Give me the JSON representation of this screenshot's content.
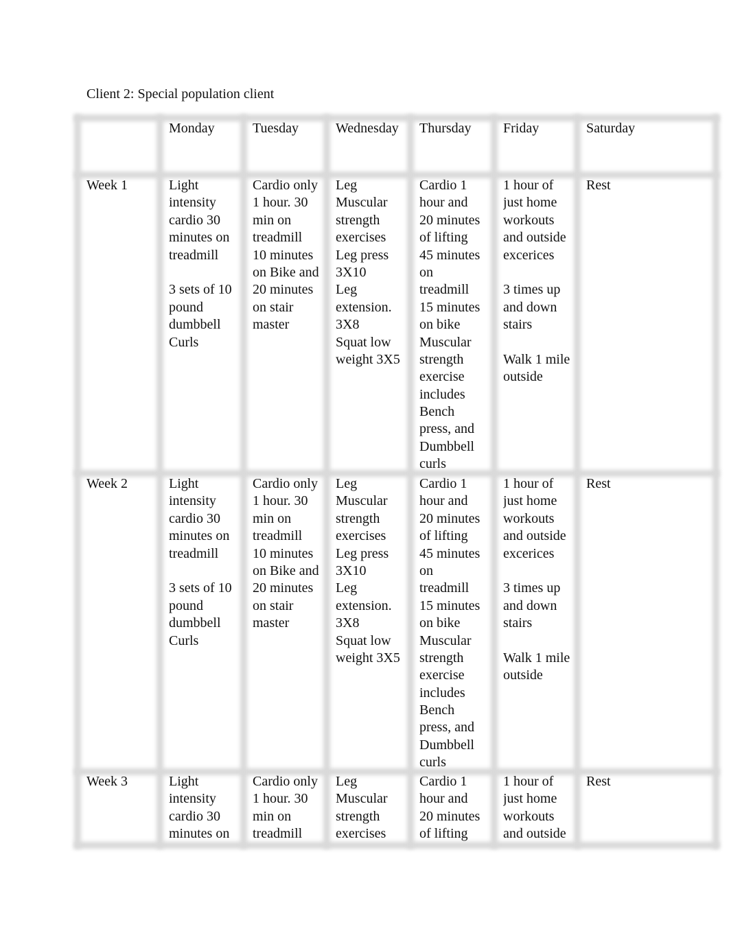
{
  "title": "Client 2: Special population client",
  "header": [
    "",
    "Monday",
    "Tuesday",
    "Wednesday",
    "Thursday",
    "Friday",
    "Saturday"
  ],
  "rows": [
    {
      "label": "Week 1",
      "cells": [
        [
          "Light",
          "intensity",
          "cardio 30",
          "minutes on",
          "treadmill",
          "",
          "3 sets of 10",
          "pound",
          "dumbbell",
          "Curls"
        ],
        [
          "Cardio only",
          "1 hour. 30",
          "min on",
          "treadmill",
          "10 minutes",
          "on Bike and",
          "20 minutes",
          "on stair",
          "master"
        ],
        [
          "Leg",
          "Muscular",
          "strength",
          "exercises",
          "Leg press",
          "3X10",
          "Leg",
          "extension.",
          "3X8",
          "Squat low",
          "weight 3X5"
        ],
        [
          "Cardio 1",
          "hour and",
          "20 minutes",
          "of lifting",
          "45 minutes",
          "on",
          "treadmill",
          "15 minutes",
          "on bike",
          "Muscular",
          "strength",
          "exercise",
          "includes",
          "Bench",
          "press, and",
          "Dumbbell",
          "curls"
        ],
        [
          "1 hour of",
          "just home",
          "workouts",
          "and outside",
          "excerices",
          "",
          "3 times up",
          "and down",
          "stairs",
          "",
          "Walk 1 mile",
          "outside"
        ],
        [
          "Rest"
        ]
      ]
    },
    {
      "label": "Week 2",
      "cells": [
        [
          "Light",
          "intensity",
          "cardio 30",
          "minutes on",
          "treadmill",
          "",
          "3 sets of 10",
          "pound",
          "dumbbell",
          "Curls"
        ],
        [
          "Cardio only",
          "1 hour. 30",
          "min on",
          "treadmill",
          "10 minutes",
          "on Bike and",
          "20 minutes",
          "on stair",
          "master"
        ],
        [
          "Leg",
          "Muscular",
          "strength",
          "exercises",
          "Leg press",
          "3X10",
          "Leg",
          "extension.",
          "3X8",
          "Squat low",
          "weight 3X5"
        ],
        [
          "Cardio 1",
          "hour and",
          "20 minutes",
          "of lifting",
          "45 minutes",
          "on",
          "treadmill",
          "15 minutes",
          "on bike",
          "Muscular",
          "strength",
          "exercise",
          "includes",
          "Bench",
          "press, and",
          "Dumbbell",
          "curls"
        ],
        [
          "1 hour of",
          "just home",
          "workouts",
          "and outside",
          "excerices",
          "",
          "3 times up",
          "and down",
          "stairs",
          "",
          "Walk 1 mile",
          "outside"
        ],
        [
          "Rest"
        ]
      ]
    },
    {
      "label": "Week 3",
      "cells": [
        [
          "Light",
          "intensity",
          "cardio 30",
          "minutes on"
        ],
        [
          "Cardio only",
          "1 hour. 30",
          "min on",
          "treadmill"
        ],
        [
          "Leg",
          "Muscular",
          "strength",
          "exercises"
        ],
        [
          "Cardio 1",
          "hour and",
          "20 minutes",
          "of lifting"
        ],
        [
          "1 hour of",
          "just home",
          "workouts",
          "and outside"
        ],
        [
          "Rest"
        ]
      ]
    }
  ]
}
